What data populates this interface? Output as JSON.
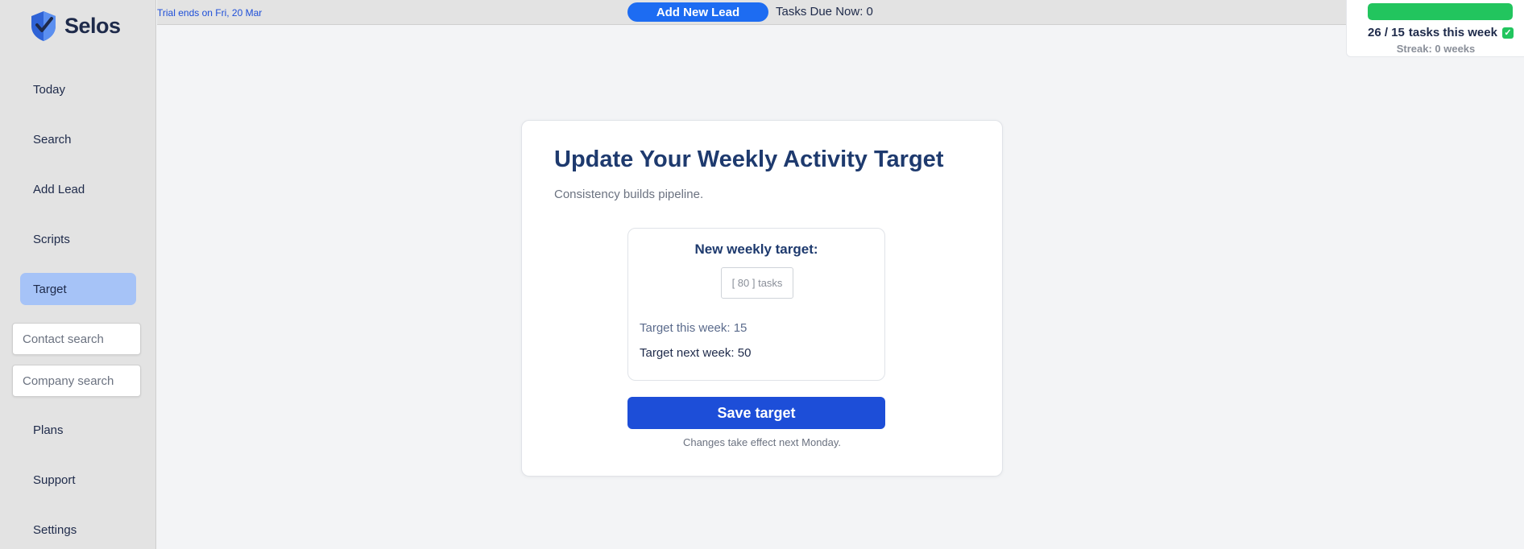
{
  "app": {
    "name": "Selos",
    "brand_color": "#1d6cf2"
  },
  "sidebar": {
    "items": [
      {
        "label": "Today"
      },
      {
        "label": "Search"
      },
      {
        "label": "Add Lead"
      },
      {
        "label": "Scripts"
      },
      {
        "label": "Target",
        "active": true
      },
      {
        "label": "Plans"
      },
      {
        "label": "Support"
      },
      {
        "label": "Settings"
      }
    ],
    "contact_search_placeholder": "Contact search",
    "company_search_placeholder": "Company search"
  },
  "topbar": {
    "trial_text": "Trial ends on Fri, 20 Mar",
    "add_lead_label": "Add New Lead",
    "tasks_due": "Tasks Due Now: 0"
  },
  "progress": {
    "completed": "26",
    "goal": "15",
    "fraction": 1.0,
    "count_text": "26 / 15",
    "label": "tasks this week",
    "streak": "Streak: 0 weeks",
    "fill_color": "#22c55e"
  },
  "card": {
    "title": "Update Your Weekly Activity Target",
    "subtitle": "Consistency builds pipeline.",
    "new_target_heading": "New weekly target:",
    "input_display": "[ 80 ]  tasks",
    "target_this_week": "Target this week: 15",
    "target_next_week": "Target next week: 50",
    "save_label": "Save target",
    "note": "Changes take effect next Monday."
  }
}
